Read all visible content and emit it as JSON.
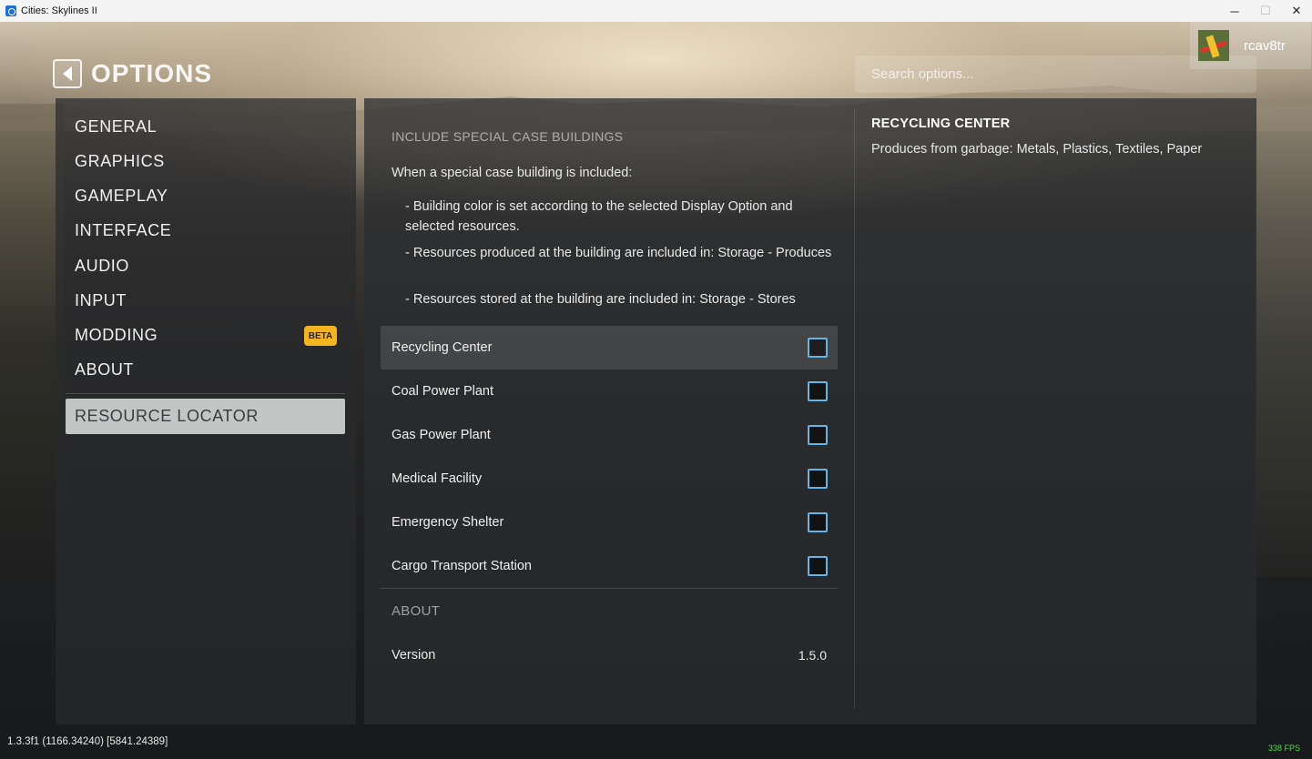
{
  "window": {
    "title": "Cities: Skylines II",
    "minimize_icon": "─",
    "maximize_icon": "☐",
    "close_icon": "✕"
  },
  "header": {
    "title": "OPTIONS",
    "search_placeholder": "Search options...",
    "username": "rcav8tr"
  },
  "nav": {
    "items": [
      "GENERAL",
      "GRAPHICS",
      "GAMEPLAY",
      "INTERFACE",
      "AUDIO",
      "INPUT",
      "MODDING",
      "ABOUT"
    ],
    "beta_label": "BETA",
    "active_item": "RESOURCE LOCATOR"
  },
  "content": {
    "section_title": "INCLUDE SPECIAL CASE BUILDINGS",
    "intro": "When a special case building is included:",
    "bullets": [
      "- Building color is set according to the selected Display Option and selected resources.",
      "- Resources produced at the building are included in: Storage - Produces",
      "- Resources stored at the building are included in: Storage - Stores"
    ],
    "options": [
      {
        "label": "Recycling Center",
        "checked": false
      },
      {
        "label": "Coal Power Plant",
        "checked": false
      },
      {
        "label": "Gas Power Plant",
        "checked": false
      },
      {
        "label": "Medical Facility",
        "checked": false
      },
      {
        "label": "Emergency Shelter",
        "checked": false
      },
      {
        "label": "Cargo Transport Station",
        "checked": false
      }
    ],
    "about_title": "ABOUT",
    "version_label": "Version",
    "version_value": "1.5.0"
  },
  "info": {
    "title": "RECYCLING CENTER",
    "text": "Produces from garbage: Metals, Plastics, Textiles, Paper"
  },
  "footer": {
    "build": "1.3.3f1 (1166.34240) [5841.24389]",
    "fps": "338 FPS"
  },
  "colors": {
    "accent_checkbox": "#62b7e8",
    "beta_badge": "#f4b51f",
    "fps_text": "#4ce04c"
  }
}
